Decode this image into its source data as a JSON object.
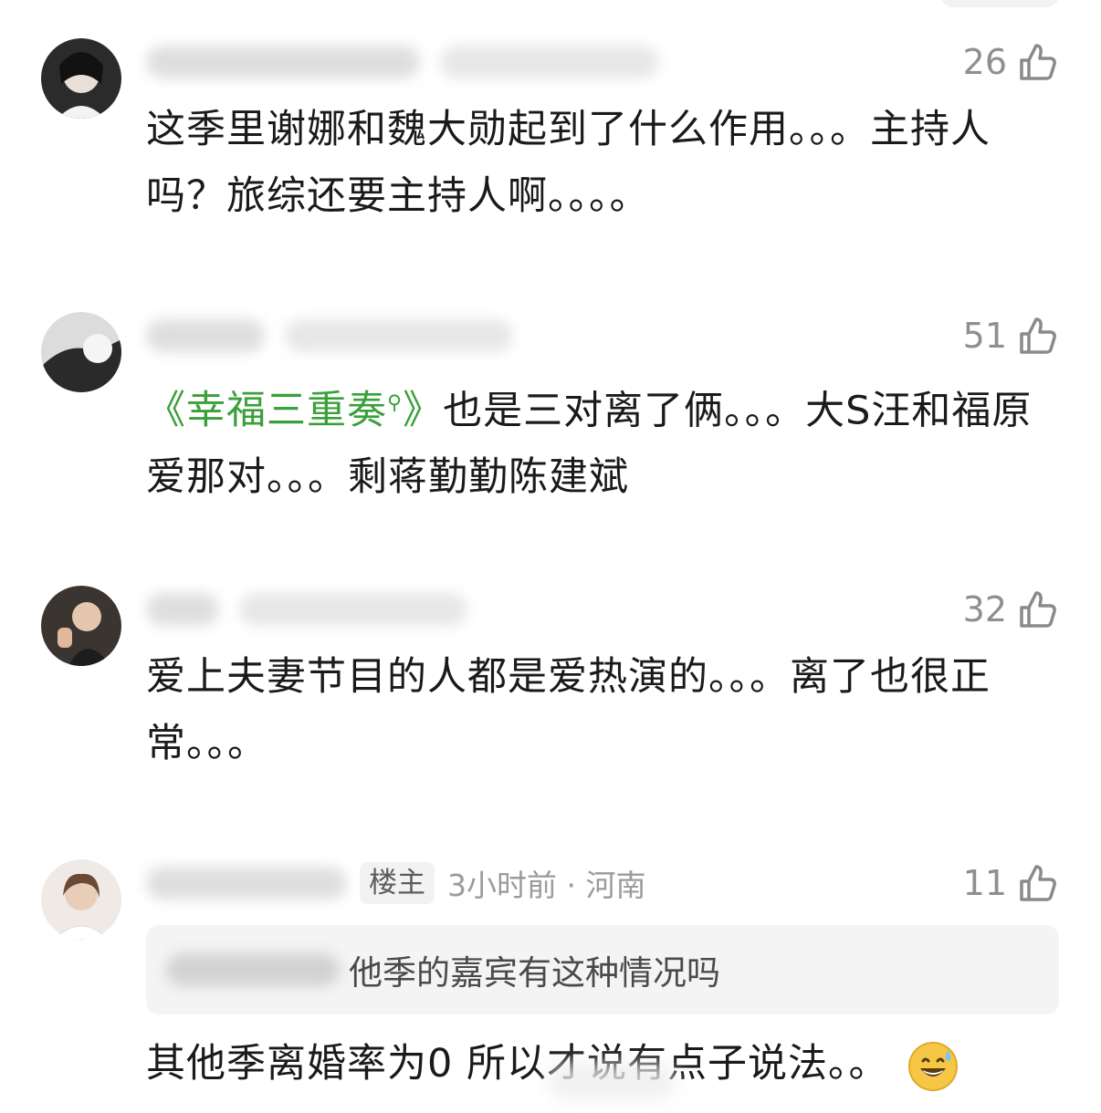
{
  "comments": [
    {
      "likes": "26",
      "text": "这季里谢娜和魏大勋起到了什么作用。。。主持人吗？旅综还要主持人啊。。。。"
    },
    {
      "likes": "51",
      "topic": "《幸福三重奏",
      "topic_suffix": "》",
      "text_after": "也是三对离了俩。。。大S汪和福原爱那对。。。剩蒋勤勤陈建斌"
    },
    {
      "likes": "32",
      "text": "爱上夫妻节目的人都是爱热演的。。。离了也很正常。。。"
    },
    {
      "likes": "11",
      "badge": "楼主",
      "time_location": "3小时前 · 河南",
      "quote": "他季的嘉宾有这种情况吗",
      "text": "其他季离婚率为0 所以才说有点子说法。。"
    }
  ],
  "icons": {
    "like": "thumbs-up-icon",
    "search": "search-icon",
    "emoji": "grinning-sweat-emoji"
  },
  "colors": {
    "topic_link": "#3aa03a",
    "meta": "#9b9b9b",
    "likes": "#8f8f8f"
  }
}
